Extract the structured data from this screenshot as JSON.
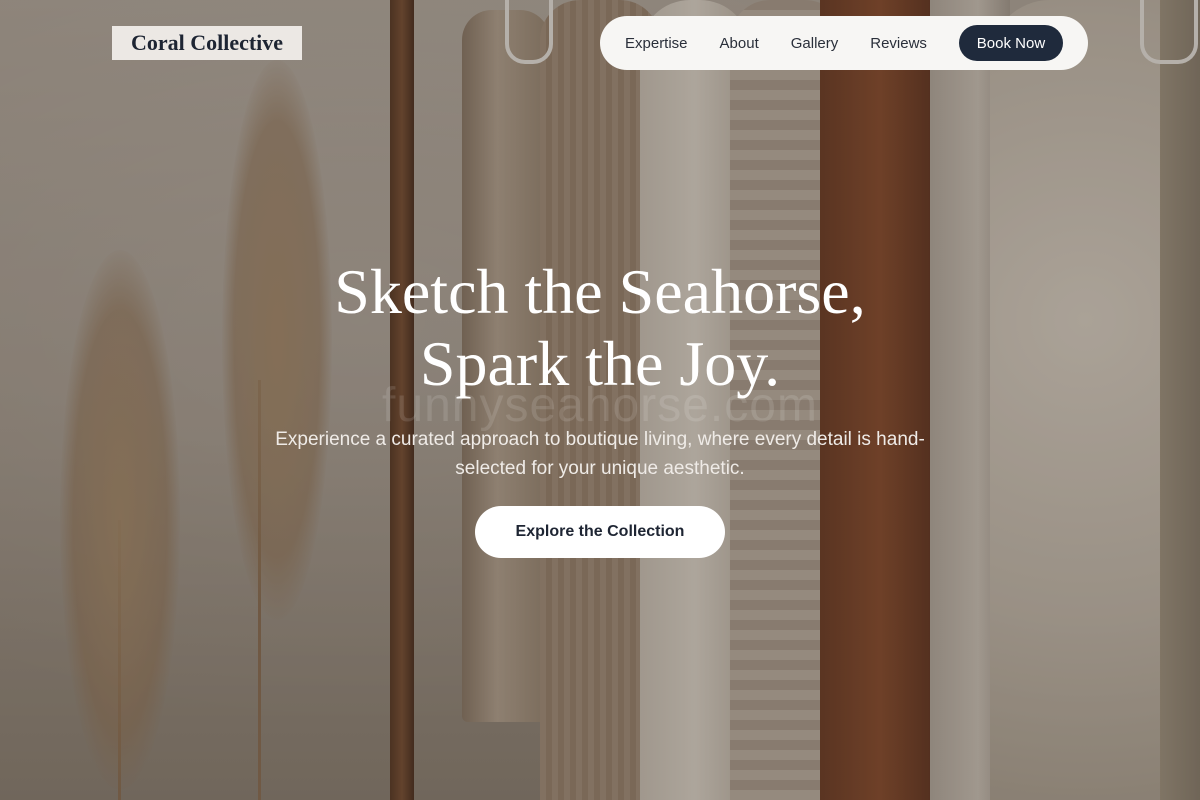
{
  "brand": {
    "logo_text": "Coral Collective"
  },
  "nav": {
    "items": [
      {
        "label": "Expertise"
      },
      {
        "label": "About"
      },
      {
        "label": "Gallery"
      },
      {
        "label": "Reviews"
      }
    ],
    "book_label": "Book Now"
  },
  "hero": {
    "title_line1": "Sketch the Seahorse,",
    "title_line2": "Spark the Joy.",
    "watermark": "funnyseahorse.com",
    "subtitle": "Experience a curated approach to boutique living, where every detail is hand-selected for your unique aesthetic.",
    "cta_label": "Explore the Collection"
  },
  "colors": {
    "accent_dark": "#1f2a3c",
    "logo_bg": "#ece8e4",
    "nav_bg": "#f7f6f4",
    "text_light": "#ffffff"
  }
}
